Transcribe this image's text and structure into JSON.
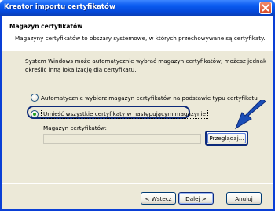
{
  "window": {
    "title": "Kreator importu certyfikatów"
  },
  "header": {
    "title": "Magazyn certyfikatów",
    "description": "Magazyny certyfikatów to obszary systemowe, w których przechowywane są certyfikaty."
  },
  "main": {
    "intro": "System Windows może automatycznie wybrać magazyn certyfikatów; możesz jednak określić inną lokalizację dla certyfikatu.",
    "option_auto": "Automatycznie wybierz magazyn certyfikatów na podstawie typu certyfikatu",
    "option_manual": "Umieść wszystkie certyfikaty w następującym magazynie",
    "store_label": "Magazyn certyfikatów:",
    "store_value": "",
    "browse_label": "Przeglądaj...",
    "selected_option": "option_manual"
  },
  "footer": {
    "back_label": "< Wstecz",
    "next_label": "Dalej >",
    "cancel_label": "Anuluj"
  },
  "colors": {
    "titlebar": "#0a5bf0",
    "annotation": "#1c4fb8"
  },
  "icons": {
    "close": "close-icon",
    "pointer": "arrow-icon"
  }
}
